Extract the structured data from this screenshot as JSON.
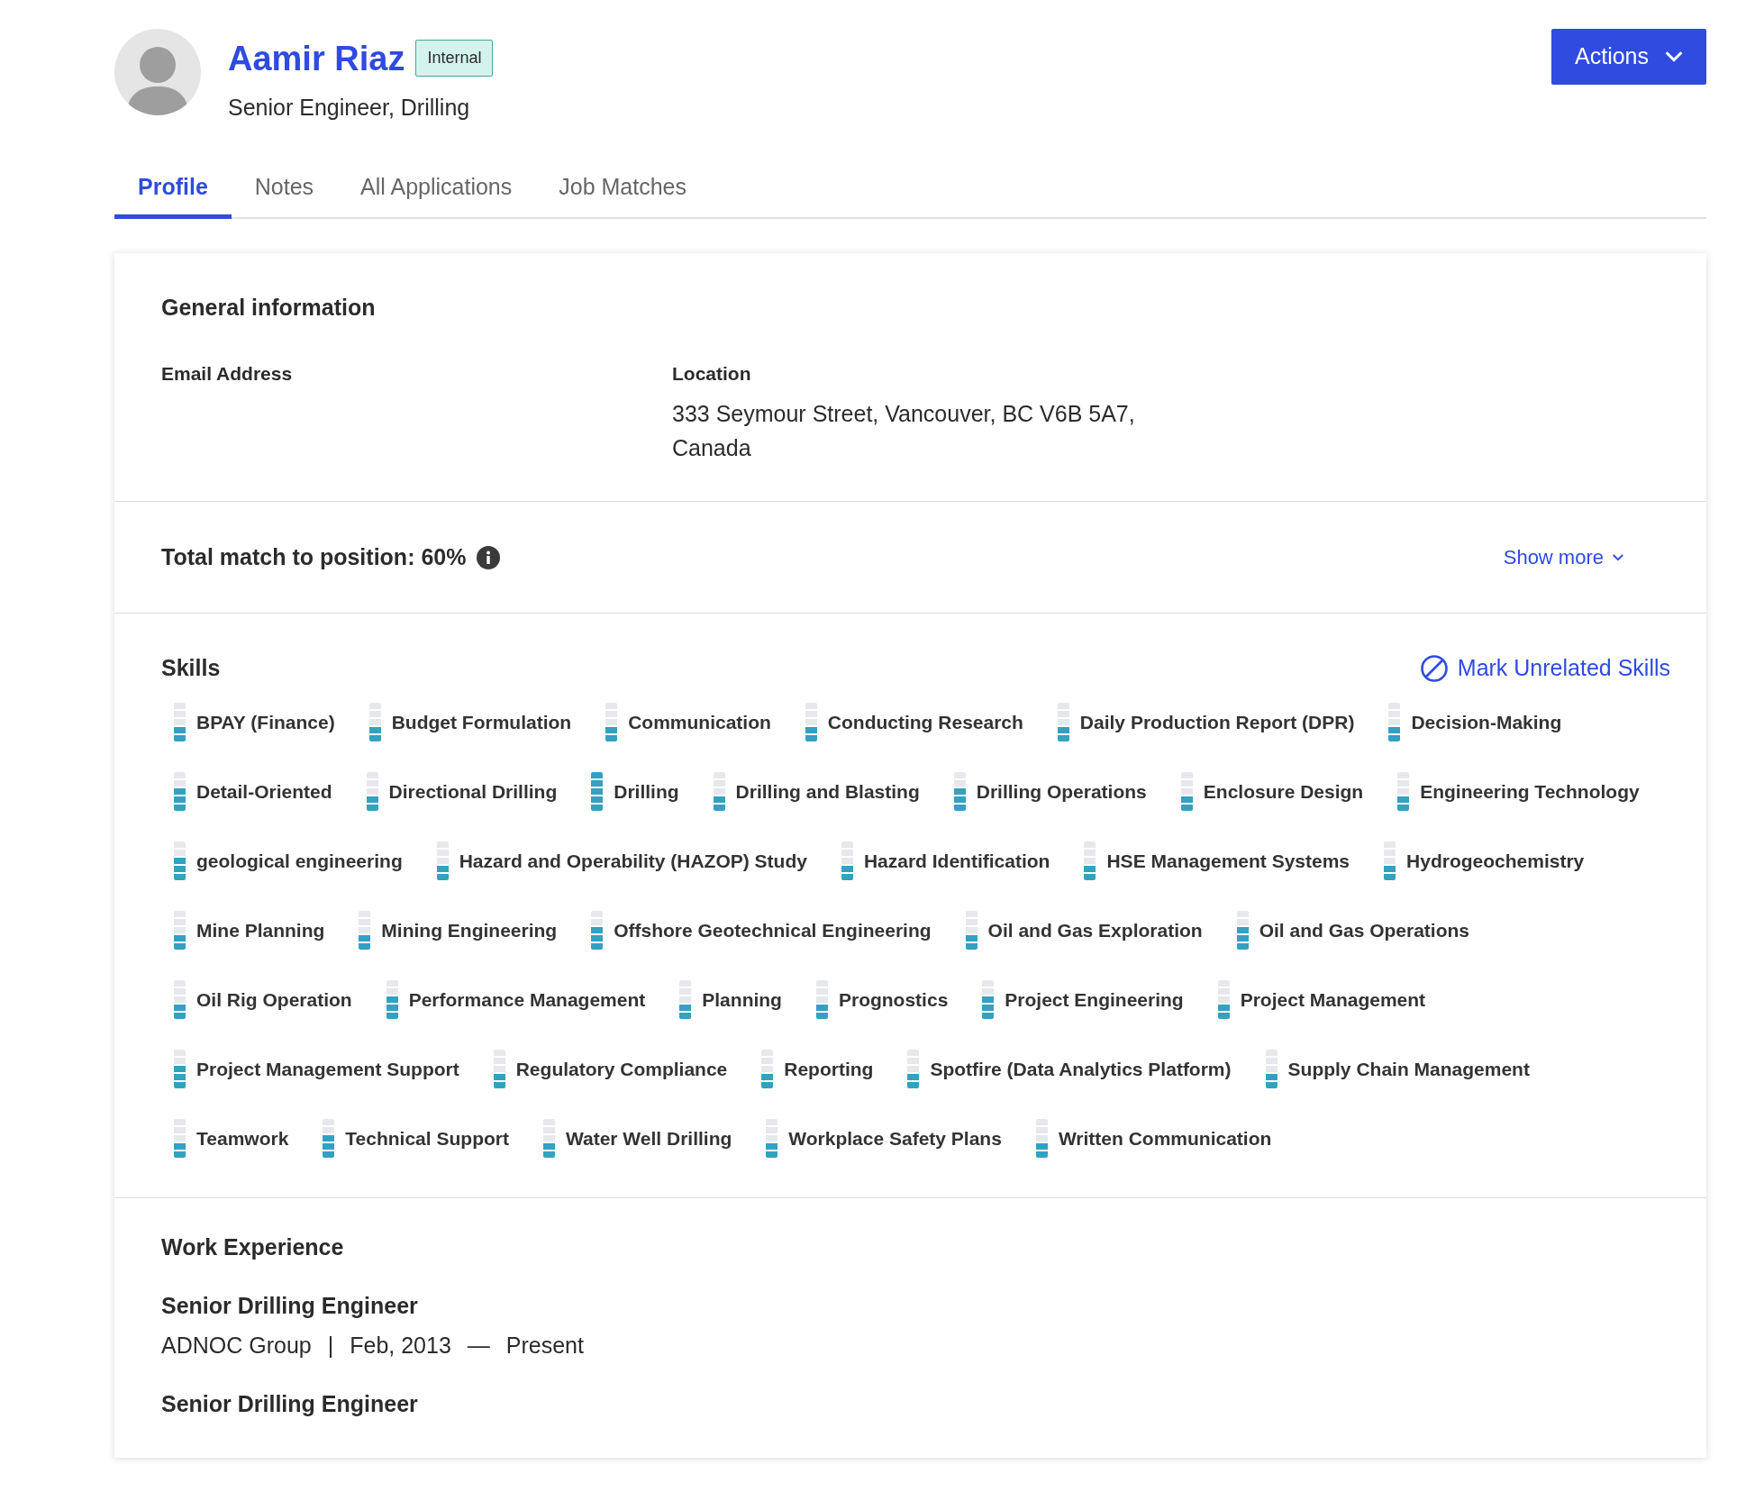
{
  "profile": {
    "name": "Aamir Riaz",
    "badge": "Internal",
    "subtitle": "Senior Engineer, Drilling"
  },
  "actions_button": "Actions",
  "tabs": [
    {
      "label": "Profile",
      "selected": true
    },
    {
      "label": "Notes",
      "selected": false
    },
    {
      "label": "All Applications",
      "selected": false
    },
    {
      "label": "Job Matches",
      "selected": false
    }
  ],
  "general_information": {
    "title": "General information",
    "fields": [
      {
        "label": "Email Address"
      },
      {
        "label": "Location",
        "value": "333 Seymour Street, Vancouver, BC V6B 5A7, Canada"
      }
    ]
  },
  "match": {
    "text": "Total match to position: 60%",
    "show_more": "Show more"
  },
  "skills": {
    "title": "Skills",
    "mark_unrelated": "Mark Unrelated Skills",
    "items": [
      {
        "name": "BPAY (Finance)",
        "level": 0.4
      },
      {
        "name": "Budget Formulation",
        "level": 0.4
      },
      {
        "name": "Communication",
        "level": 0.4
      },
      {
        "name": "Conducting Research",
        "level": 0.4
      },
      {
        "name": "Daily Production Report (DPR)",
        "level": 0.4
      },
      {
        "name": "Decision-Making",
        "level": 0.4
      },
      {
        "name": "Detail-Oriented",
        "level": 0.6
      },
      {
        "name": "Directional Drilling",
        "level": 0.4
      },
      {
        "name": "Drilling",
        "level": 1
      },
      {
        "name": "Drilling and Blasting",
        "level": 0.4
      },
      {
        "name": "Drilling Operations",
        "level": 0.6
      },
      {
        "name": "Enclosure Design",
        "level": 0.4
      },
      {
        "name": "Engineering Technology",
        "level": 0.4
      },
      {
        "name": "geological engineering",
        "level": 0.6
      },
      {
        "name": "Hazard and Operability (HAZOP) Study",
        "level": 0.4
      },
      {
        "name": "Hazard Identification",
        "level": 0.4
      },
      {
        "name": "HSE Management Systems",
        "level": 0.4
      },
      {
        "name": "Hydrogeochemistry",
        "level": 0.4
      },
      {
        "name": "Mine Planning",
        "level": 0.4
      },
      {
        "name": "Mining Engineering",
        "level": 0.4
      },
      {
        "name": "Offshore Geotechnical Engineering",
        "level": 0.6
      },
      {
        "name": "Oil and Gas Exploration",
        "level": 0.4
      },
      {
        "name": "Oil and Gas Operations",
        "level": 0.6
      },
      {
        "name": "Oil Rig Operation",
        "level": 0.4
      },
      {
        "name": "Performance Management",
        "level": 0.6
      },
      {
        "name": "Planning",
        "level": 0.4
      },
      {
        "name": "Prognostics",
        "level": 0.4
      },
      {
        "name": "Project Engineering",
        "level": 0.6
      },
      {
        "name": "Project Management",
        "level": 0.4
      },
      {
        "name": "Project Management Support",
        "level": 0.6
      },
      {
        "name": "Regulatory Compliance",
        "level": 0.4
      },
      {
        "name": "Reporting",
        "level": 0.4
      },
      {
        "name": "Spotfire (Data Analytics Platform)",
        "level": 0.4
      },
      {
        "name": "Supply Chain Management",
        "level": 0.4
      },
      {
        "name": "Teamwork",
        "level": 0.4
      },
      {
        "name": "Technical Support",
        "level": 0.6
      },
      {
        "name": "Water Well Drilling",
        "level": 0.4
      },
      {
        "name": "Workplace Safety Plans",
        "level": 0.4
      },
      {
        "name": "Written Communication",
        "level": 0.4
      }
    ]
  },
  "work_experience": {
    "title": "Work Experience",
    "jobs": [
      {
        "title": "Senior Drilling Engineer",
        "company": "ADNOC Group",
        "separator": "|",
        "start": "Feb, 2013",
        "dash": "—",
        "end": "Present"
      },
      {
        "title": "Senior Drilling Engineer"
      }
    ]
  }
}
